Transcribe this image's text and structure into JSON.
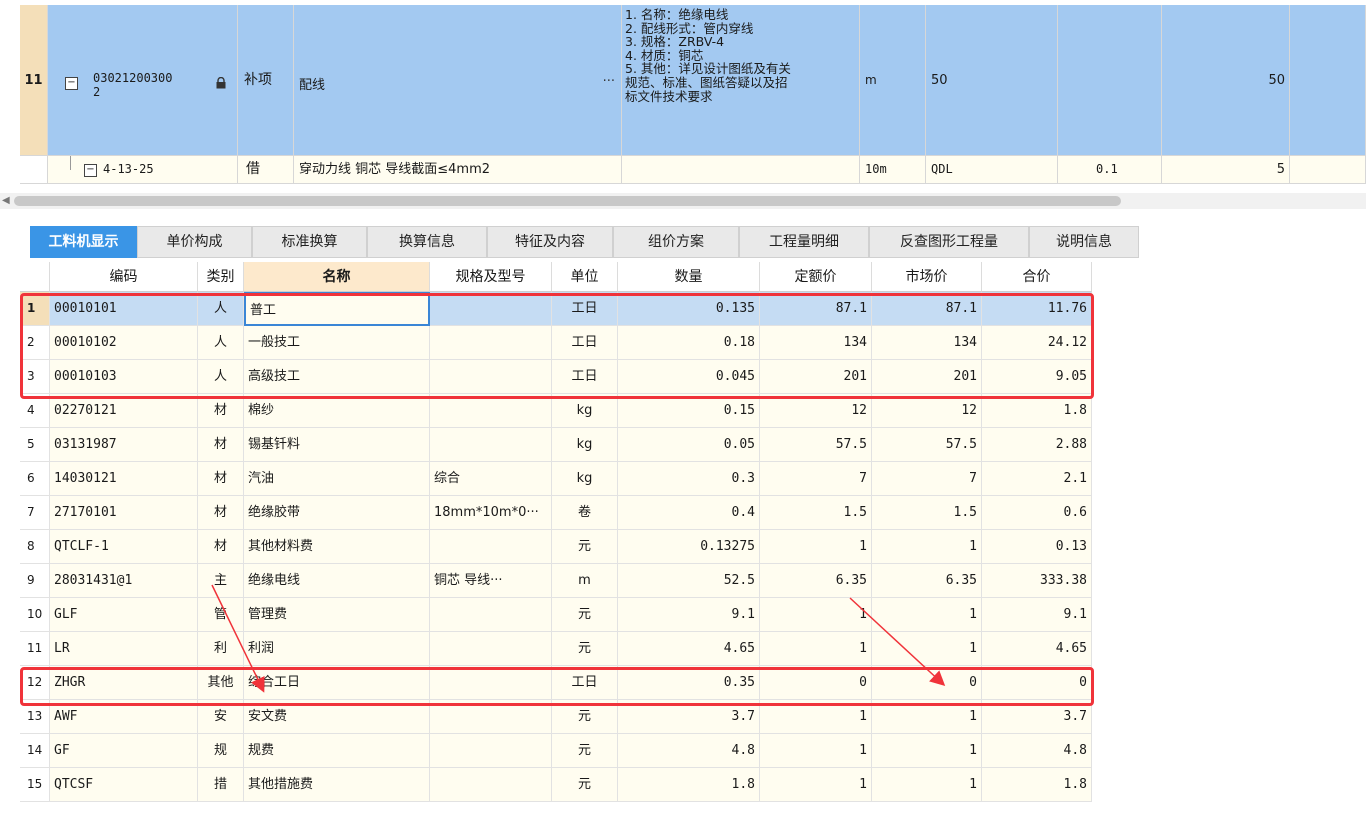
{
  "top_rows": {
    "row11": {
      "row_num": "11",
      "code": "03021200300\n2",
      "type": "补项",
      "name": "配线",
      "more": "···",
      "features": [
        "1. 名称：绝缘电线",
        "2. 配线形式：管内穿线",
        "3. 规格：ZRBV-4",
        "4. 材质：铜芯",
        "5. 其他：详见设计图纸及有关",
        "规范、标准、图纸答疑以及招",
        "标文件技术要求"
      ],
      "unit": "m",
      "expr": "50",
      "qty": "50"
    },
    "sub": {
      "code": "4-13-25",
      "type": "借",
      "name": "穿动力线 铜芯 导线截面≤4mm2",
      "unit": "10m",
      "expr": "QDL",
      "coef": "0.1",
      "qty": "5"
    }
  },
  "tabs": [
    "工料机显示",
    "单价构成",
    "标准换算",
    "换算信息",
    "特征及内容",
    "组价方案",
    "工程量明细",
    "反查图形工程量",
    "说明信息"
  ],
  "active_tab": "工料机显示",
  "detail": {
    "headers": [
      "编码",
      "类别",
      "名称",
      "规格及型号",
      "单位",
      "数量",
      "定额价",
      "市场价",
      "合价"
    ],
    "rows": [
      {
        "n": "1",
        "code": "00010101",
        "cat": "人",
        "name": "普工",
        "spec": "",
        "unit": "工日",
        "qty": "0.135",
        "base": "87.1",
        "market": "87.1",
        "total": "11.76"
      },
      {
        "n": "2",
        "code": "00010102",
        "cat": "人",
        "name": "一般技工",
        "spec": "",
        "unit": "工日",
        "qty": "0.18",
        "base": "134",
        "market": "134",
        "total": "24.12"
      },
      {
        "n": "3",
        "code": "00010103",
        "cat": "人",
        "name": "高级技工",
        "spec": "",
        "unit": "工日",
        "qty": "0.045",
        "base": "201",
        "market": "201",
        "total": "9.05"
      },
      {
        "n": "4",
        "code": "02270121",
        "cat": "材",
        "name": "棉纱",
        "spec": "",
        "unit": "kg",
        "qty": "0.15",
        "base": "12",
        "market": "12",
        "total": "1.8"
      },
      {
        "n": "5",
        "code": "03131987",
        "cat": "材",
        "name": "锡基钎料",
        "spec": "",
        "unit": "kg",
        "qty": "0.05",
        "base": "57.5",
        "market": "57.5",
        "total": "2.88"
      },
      {
        "n": "6",
        "code": "14030121",
        "cat": "材",
        "name": "汽油",
        "spec": "综合",
        "unit": "kg",
        "qty": "0.3",
        "base": "7",
        "market": "7",
        "total": "2.1"
      },
      {
        "n": "7",
        "code": "27170101",
        "cat": "材",
        "name": "绝缘胶带",
        "spec": "18mm*10m*0···",
        "unit": "卷",
        "qty": "0.4",
        "base": "1.5",
        "market": "1.5",
        "total": "0.6"
      },
      {
        "n": "8",
        "code": "QTCLF-1",
        "cat": "材",
        "name": "其他材料费",
        "spec": "",
        "unit": "元",
        "qty": "0.13275",
        "base": "1",
        "market": "1",
        "total": "0.13"
      },
      {
        "n": "9",
        "code": "28031431@1",
        "cat": "主",
        "name": "绝缘电线",
        "spec": "铜芯 导线···",
        "unit": "m",
        "qty": "52.5",
        "base": "6.35",
        "market": "6.35",
        "total": "333.38"
      },
      {
        "n": "10",
        "code": "GLF",
        "cat": "管",
        "name": "管理费",
        "spec": "",
        "unit": "元",
        "qty": "9.1",
        "base": "1",
        "market": "1",
        "total": "9.1"
      },
      {
        "n": "11",
        "code": "LR",
        "cat": "利",
        "name": "利润",
        "spec": "",
        "unit": "元",
        "qty": "4.65",
        "base": "1",
        "market": "1",
        "total": "4.65"
      },
      {
        "n": "12",
        "code": "ZHGR",
        "cat": "其他",
        "name": "综合工日",
        "spec": "",
        "unit": "工日",
        "qty": "0.35",
        "base": "0",
        "market": "0",
        "total": "0"
      },
      {
        "n": "13",
        "code": "AWF",
        "cat": "安",
        "name": "安文费",
        "spec": "",
        "unit": "元",
        "qty": "3.7",
        "base": "1",
        "market": "1",
        "total": "3.7"
      },
      {
        "n": "14",
        "code": "GF",
        "cat": "规",
        "name": "规费",
        "spec": "",
        "unit": "元",
        "qty": "4.8",
        "base": "1",
        "market": "1",
        "total": "4.8"
      },
      {
        "n": "15",
        "code": "QTCSF",
        "cat": "措",
        "name": "其他措施费",
        "spec": "",
        "unit": "元",
        "qty": "1.8",
        "base": "1",
        "market": "1",
        "total": "1.8"
      }
    ]
  },
  "colors": {
    "selected_row": "#c5dcf3",
    "tab_active": "#3a95e6",
    "highlight_box": "#f0333a",
    "cell_bg": "#fffdf0"
  }
}
